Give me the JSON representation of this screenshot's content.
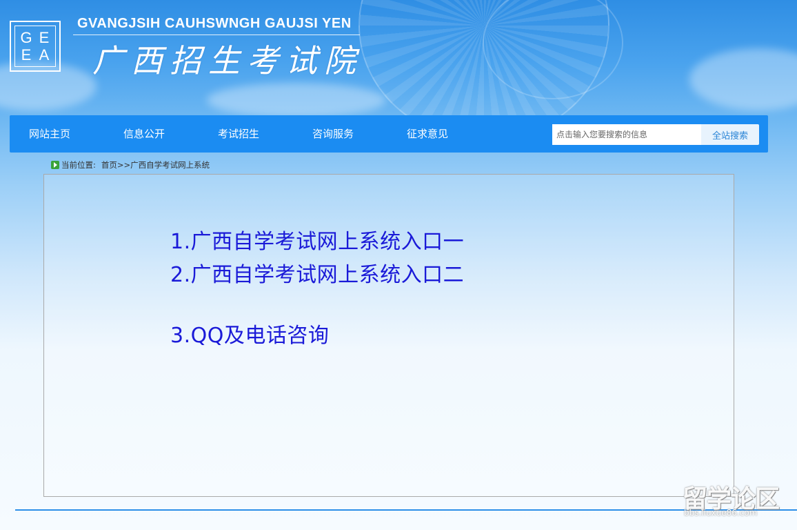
{
  "header": {
    "logo_letters": [
      "G",
      "E",
      "E",
      "A"
    ],
    "site_name_en": "GVANGJSIH CAUHSWNGH GAUJSI YEN",
    "site_name_cn": "广西招生考试院"
  },
  "nav": {
    "items": [
      {
        "label": "网站主页"
      },
      {
        "label": "信息公开"
      },
      {
        "label": "考试招生"
      },
      {
        "label": "咨询服务"
      },
      {
        "label": "征求意见"
      }
    ],
    "search": {
      "placeholder": "点击输入您要搜索的信息",
      "button_label": "全站搜索"
    }
  },
  "breadcrumb": {
    "prefix": "当前位置:",
    "home": "首页",
    "separator": ">>",
    "current": "广西自学考试网上系统"
  },
  "content": {
    "links": [
      {
        "label": "1.广西自学考试网上系统入口一"
      },
      {
        "label": "2.广西自学考试网上系统入口二"
      },
      {
        "label": "3.QQ及电话咨询"
      }
    ]
  },
  "watermark": {
    "text": "留学论区",
    "url": "bbs.liuxue86.com"
  },
  "colors": {
    "nav_bg": "#1b8cf2",
    "link": "#1a1ad8",
    "accent_line": "#2b8ee8"
  }
}
